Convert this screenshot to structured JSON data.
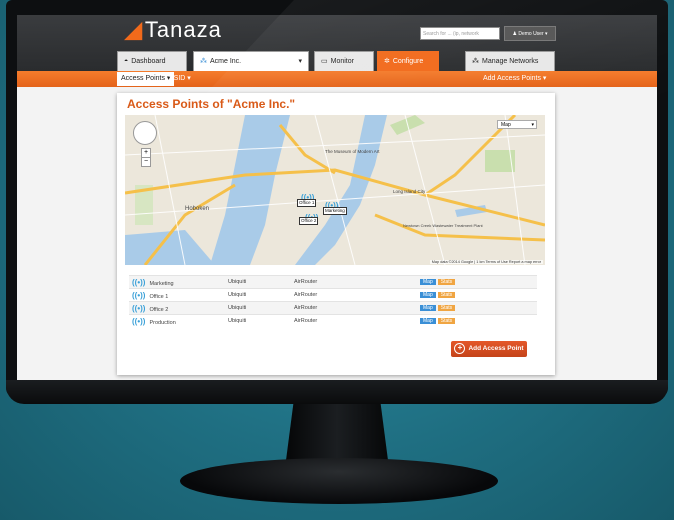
{
  "app": {
    "logo_text": "Tanaza"
  },
  "header": {
    "search_placeholder": "Search for ... (ip, network",
    "user_menu": "Demo User ▾"
  },
  "tabs": {
    "dashboard": "Dashboard",
    "organization": "Acme Inc.",
    "monitor": "Monitor",
    "configure": "Configure",
    "manage_networks": "Manage Networks"
  },
  "nav": {
    "access_points": "Access Points ▾",
    "ssid": "SSID ▾",
    "add_access_points": "Add Access Points ▾"
  },
  "page": {
    "title": "Access Points of \"Acme Inc.\""
  },
  "map": {
    "type_select": "Map",
    "markers": [
      "Office 1",
      "Office 2",
      "Marketing"
    ],
    "attribution": "Map data ©2014 Google | 1 km  Terms of Use  Report a map error",
    "place_labels": [
      "Hoboken",
      "The Museum of Modern Art",
      "Long Island City",
      "Newtown Creek Wastewater Treatment Plant"
    ]
  },
  "table": {
    "rows": [
      {
        "name": "Marketing",
        "vendor": "Ubiquiti",
        "model": "AirRouter"
      },
      {
        "name": "Office 1",
        "vendor": "Ubiquiti",
        "model": "AirRouter"
      },
      {
        "name": "Office 2",
        "vendor": "Ubiquiti",
        "model": "AirRouter"
      },
      {
        "name": "Production",
        "vendor": "Ubiquiti",
        "model": "AirRouter"
      }
    ],
    "map_button": "Map",
    "stats_button": "Stats"
  },
  "actions": {
    "add_access_point": "Add Access Point"
  },
  "colors": {
    "accent": "#f26a1b",
    "map_button": "#3a8fd6",
    "stats_button": "#f0a542"
  }
}
